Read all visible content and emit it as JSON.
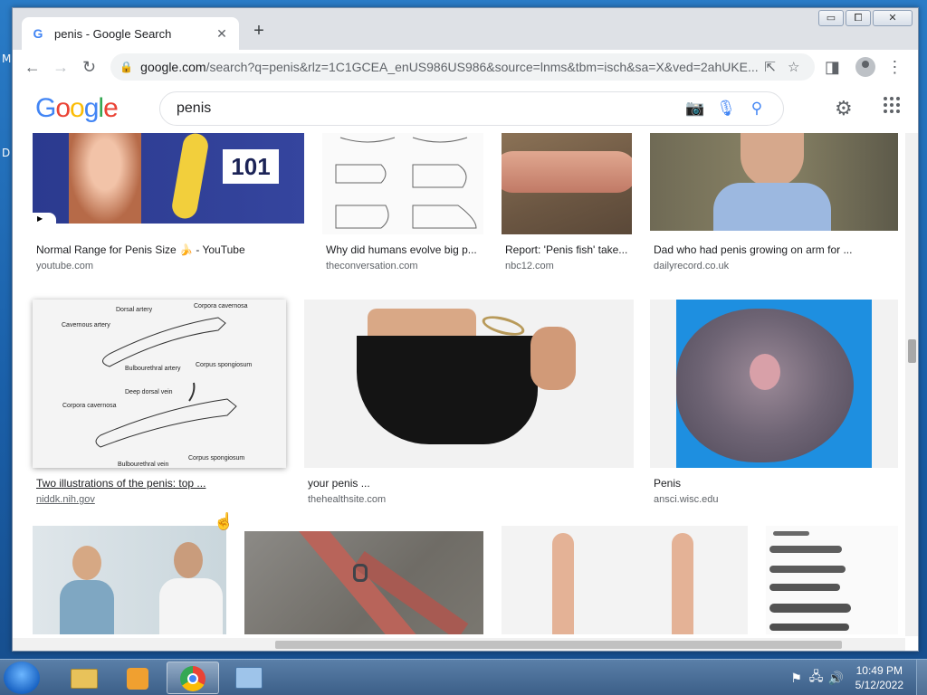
{
  "browser": {
    "tab_title": "penis - Google Search",
    "tab_close": "✕",
    "new_tab": "+",
    "url_host": "google.com",
    "url_rest": "/search?q=penis&rlz=1C1GCEA_enUS986US986&source=lnms&tbm=isch&sa=X&ved=2ahUKE...",
    "window_controls": [
      "▭",
      "⧠",
      "✕"
    ]
  },
  "desktop": {
    "letters": [
      "M",
      "D"
    ]
  },
  "search": {
    "logo": [
      "G",
      "o",
      "o",
      "g",
      "l",
      "e"
    ],
    "query": "penis"
  },
  "results": [
    {
      "caption": "Normal Range for Penis Size 🍌 - YouTube",
      "source": "youtube.com"
    },
    {
      "caption": "Why did humans evolve big p...",
      "source": "theconversation.com"
    },
    {
      "caption": "Report: 'Penis fish' take...",
      "source": "nbc12.com"
    },
    {
      "caption": "Dad who had penis growing on arm for ...",
      "source": "dailyrecord.co.uk"
    },
    {
      "caption": "Two illustrations of the penis: top ...",
      "source": "niddk.nih.gov"
    },
    {
      "caption": "your penis ...",
      "source": "thehealthsite.com"
    },
    {
      "caption": "Penis",
      "source": "ansci.wisc.edu"
    }
  ],
  "thumbnails": {
    "yt_badge": "101",
    "diagram_labels": [
      "Dorsal artery",
      "Corpora cavernosa",
      "Cavernous artery",
      "Bulbourethral artery",
      "Corpus spongiosum",
      "Deep dorsal vein",
      "Corpora cavernosa",
      "Bulbourethral vein",
      "Corpus spongiosum"
    ]
  },
  "taskbar": {
    "time": "10:49 PM",
    "date": "5/12/2022"
  },
  "colors": {
    "accent": "#4285f4",
    "mic_blue": "#4285f4",
    "taskbar": "#3c5f88"
  }
}
